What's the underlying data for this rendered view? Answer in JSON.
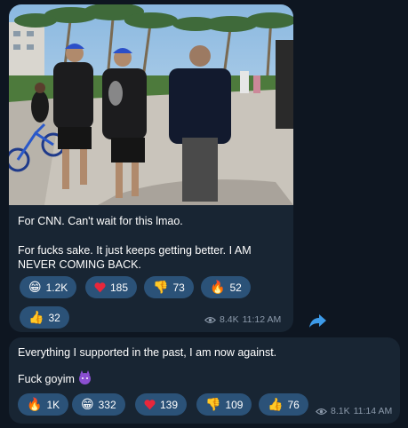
{
  "colors": {
    "background": "#0e1621",
    "bubble": "#182533",
    "reaction": "#2b5278",
    "meta": "#8c9aab",
    "share": "#3d9be9"
  },
  "message1": {
    "line1": "For CNN. Can't wait for this lmao.",
    "line2": "For fucks sake. It just keeps getting better. I AM NEVER COMING BACK.",
    "reactions": [
      {
        "icon": "grinning-face-icon",
        "emoji": "😁",
        "count": "1.2K"
      },
      {
        "icon": "heart-icon",
        "emoji": "❤",
        "count": "185"
      },
      {
        "icon": "thumbs-down-icon",
        "emoji": "👎",
        "count": "73"
      },
      {
        "icon": "fire-icon",
        "emoji": "🔥",
        "count": "52"
      },
      {
        "icon": "thumbs-up-icon",
        "emoji": "👍",
        "count": "32"
      }
    ],
    "views": "8.4K",
    "time": "11:12 AM"
  },
  "message2": {
    "line1": "Everything I supported in the past, I am now against.",
    "line2": "Fuck goyim",
    "reactions": [
      {
        "icon": "fire-icon",
        "emoji": "🔥",
        "count": "1K"
      },
      {
        "icon": "grinning-face-icon",
        "emoji": "😁",
        "count": "332"
      },
      {
        "icon": "heart-icon",
        "emoji": "❤",
        "count": "139"
      },
      {
        "icon": "thumbs-down-icon",
        "emoji": "👎",
        "count": "109"
      },
      {
        "icon": "thumbs-up-icon",
        "emoji": "👍",
        "count": "76"
      }
    ],
    "views": "8.1K",
    "time": "11:14 AM"
  }
}
